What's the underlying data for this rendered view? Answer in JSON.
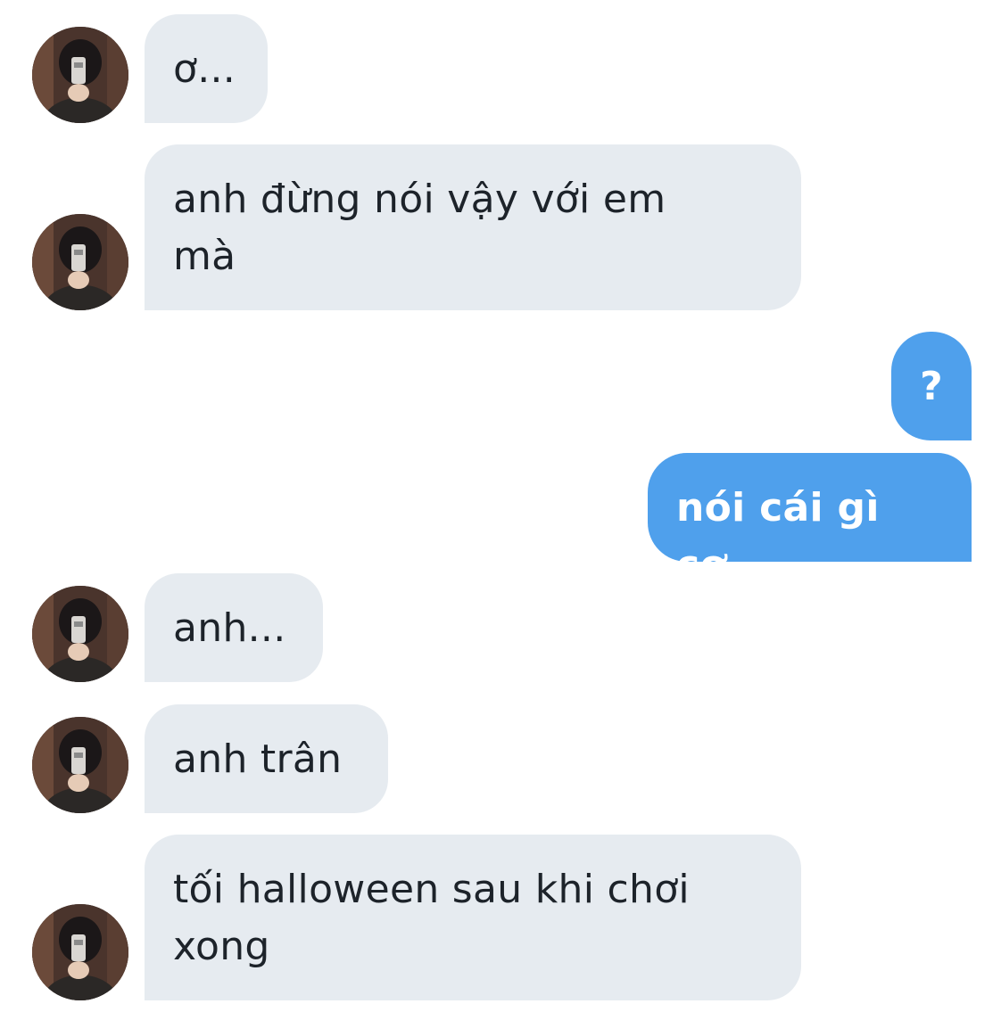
{
  "conversation": {
    "messages": [
      {
        "sender": "contact",
        "text": "ơ..."
      },
      {
        "sender": "contact",
        "text": "anh đừng nói vậy với em\nmà"
      },
      {
        "sender": "me",
        "text": "?"
      },
      {
        "sender": "me",
        "text": "nói cái gì cơ"
      },
      {
        "sender": "contact",
        "text": "anh..."
      },
      {
        "sender": "contact",
        "text": "anh trân"
      },
      {
        "sender": "contact",
        "text": "tối halloween sau khi chơi\nxong"
      }
    ]
  },
  "colors": {
    "incoming_bubble": "#e6ebf0",
    "outgoing_bubble": "#4fa0ec",
    "incoming_text": "#1d232a",
    "outgoing_text": "#ffffff"
  },
  "icons": {
    "contact_avatar": "avatar-photo-icon"
  }
}
